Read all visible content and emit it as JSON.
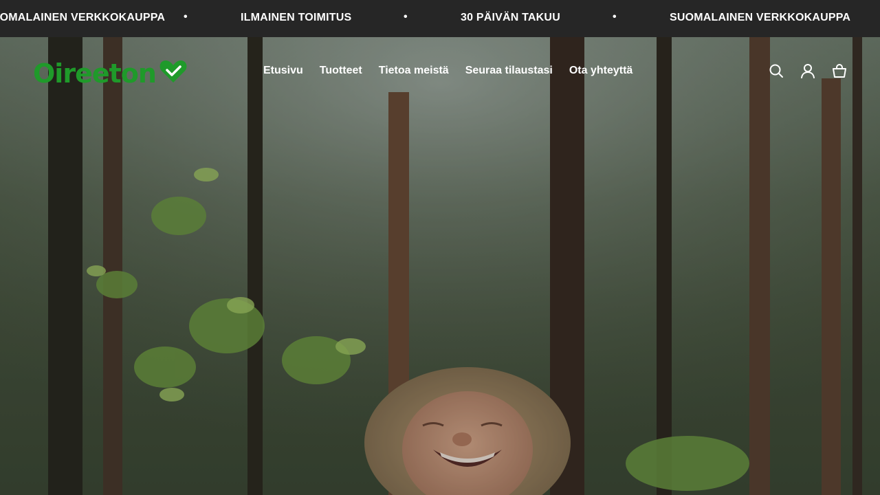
{
  "announcement": {
    "items": [
      "SUOMALAINEN VERKKOKAUPPA",
      "ILMAINEN TOIMITUS",
      "30 PÄIVÄN TAKUU",
      "SUOMALAINEN VERKKOKAUPPA"
    ],
    "separator": "•"
  },
  "header": {
    "logo_text": "Oireeton",
    "logo_color": "#1f9a2a",
    "nav": [
      "Etusivu",
      "Tuotteet",
      "Tietoa meistä",
      "Seuraa tilaustasi",
      "Ota yhteyttä"
    ],
    "icons": [
      "search-icon",
      "account-icon",
      "cart-icon"
    ]
  },
  "hero": {
    "image": "forest-woman-smiling-photo"
  }
}
